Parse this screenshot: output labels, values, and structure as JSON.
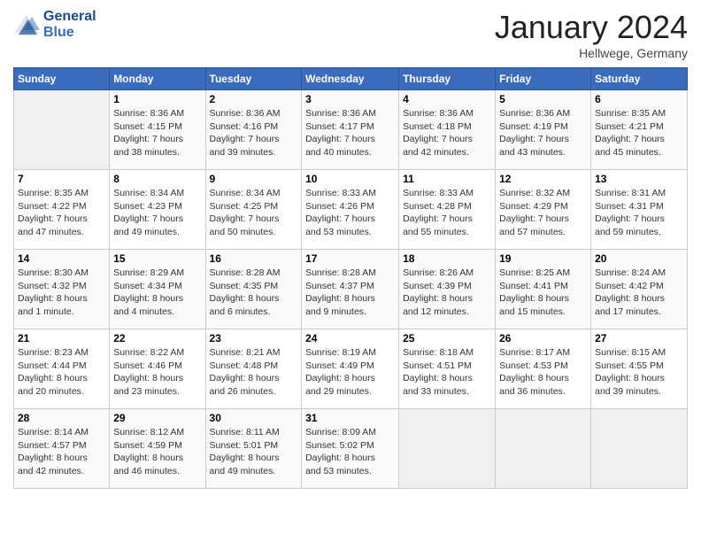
{
  "header": {
    "logo_line1": "General",
    "logo_line2": "Blue",
    "month": "January 2024",
    "location": "Hellwege, Germany"
  },
  "days_of_week": [
    "Sunday",
    "Monday",
    "Tuesday",
    "Wednesday",
    "Thursday",
    "Friday",
    "Saturday"
  ],
  "weeks": [
    [
      {
        "day": "",
        "info": ""
      },
      {
        "day": "1",
        "info": "Sunrise: 8:36 AM\nSunset: 4:15 PM\nDaylight: 7 hours\nand 38 minutes."
      },
      {
        "day": "2",
        "info": "Sunrise: 8:36 AM\nSunset: 4:16 PM\nDaylight: 7 hours\nand 39 minutes."
      },
      {
        "day": "3",
        "info": "Sunrise: 8:36 AM\nSunset: 4:17 PM\nDaylight: 7 hours\nand 40 minutes."
      },
      {
        "day": "4",
        "info": "Sunrise: 8:36 AM\nSunset: 4:18 PM\nDaylight: 7 hours\nand 42 minutes."
      },
      {
        "day": "5",
        "info": "Sunrise: 8:36 AM\nSunset: 4:19 PM\nDaylight: 7 hours\nand 43 minutes."
      },
      {
        "day": "6",
        "info": "Sunrise: 8:35 AM\nSunset: 4:21 PM\nDaylight: 7 hours\nand 45 minutes."
      }
    ],
    [
      {
        "day": "7",
        "info": "Sunrise: 8:35 AM\nSunset: 4:22 PM\nDaylight: 7 hours\nand 47 minutes."
      },
      {
        "day": "8",
        "info": "Sunrise: 8:34 AM\nSunset: 4:23 PM\nDaylight: 7 hours\nand 49 minutes."
      },
      {
        "day": "9",
        "info": "Sunrise: 8:34 AM\nSunset: 4:25 PM\nDaylight: 7 hours\nand 50 minutes."
      },
      {
        "day": "10",
        "info": "Sunrise: 8:33 AM\nSunset: 4:26 PM\nDaylight: 7 hours\nand 53 minutes."
      },
      {
        "day": "11",
        "info": "Sunrise: 8:33 AM\nSunset: 4:28 PM\nDaylight: 7 hours\nand 55 minutes."
      },
      {
        "day": "12",
        "info": "Sunrise: 8:32 AM\nSunset: 4:29 PM\nDaylight: 7 hours\nand 57 minutes."
      },
      {
        "day": "13",
        "info": "Sunrise: 8:31 AM\nSunset: 4:31 PM\nDaylight: 7 hours\nand 59 minutes."
      }
    ],
    [
      {
        "day": "14",
        "info": "Sunrise: 8:30 AM\nSunset: 4:32 PM\nDaylight: 8 hours\nand 1 minute."
      },
      {
        "day": "15",
        "info": "Sunrise: 8:29 AM\nSunset: 4:34 PM\nDaylight: 8 hours\nand 4 minutes."
      },
      {
        "day": "16",
        "info": "Sunrise: 8:28 AM\nSunset: 4:35 PM\nDaylight: 8 hours\nand 6 minutes."
      },
      {
        "day": "17",
        "info": "Sunrise: 8:28 AM\nSunset: 4:37 PM\nDaylight: 8 hours\nand 9 minutes."
      },
      {
        "day": "18",
        "info": "Sunrise: 8:26 AM\nSunset: 4:39 PM\nDaylight: 8 hours\nand 12 minutes."
      },
      {
        "day": "19",
        "info": "Sunrise: 8:25 AM\nSunset: 4:41 PM\nDaylight: 8 hours\nand 15 minutes."
      },
      {
        "day": "20",
        "info": "Sunrise: 8:24 AM\nSunset: 4:42 PM\nDaylight: 8 hours\nand 17 minutes."
      }
    ],
    [
      {
        "day": "21",
        "info": "Sunrise: 8:23 AM\nSunset: 4:44 PM\nDaylight: 8 hours\nand 20 minutes."
      },
      {
        "day": "22",
        "info": "Sunrise: 8:22 AM\nSunset: 4:46 PM\nDaylight: 8 hours\nand 23 minutes."
      },
      {
        "day": "23",
        "info": "Sunrise: 8:21 AM\nSunset: 4:48 PM\nDaylight: 8 hours\nand 26 minutes."
      },
      {
        "day": "24",
        "info": "Sunrise: 8:19 AM\nSunset: 4:49 PM\nDaylight: 8 hours\nand 29 minutes."
      },
      {
        "day": "25",
        "info": "Sunrise: 8:18 AM\nSunset: 4:51 PM\nDaylight: 8 hours\nand 33 minutes."
      },
      {
        "day": "26",
        "info": "Sunrise: 8:17 AM\nSunset: 4:53 PM\nDaylight: 8 hours\nand 36 minutes."
      },
      {
        "day": "27",
        "info": "Sunrise: 8:15 AM\nSunset: 4:55 PM\nDaylight: 8 hours\nand 39 minutes."
      }
    ],
    [
      {
        "day": "28",
        "info": "Sunrise: 8:14 AM\nSunset: 4:57 PM\nDaylight: 8 hours\nand 42 minutes."
      },
      {
        "day": "29",
        "info": "Sunrise: 8:12 AM\nSunset: 4:59 PM\nDaylight: 8 hours\nand 46 minutes."
      },
      {
        "day": "30",
        "info": "Sunrise: 8:11 AM\nSunset: 5:01 PM\nDaylight: 8 hours\nand 49 minutes."
      },
      {
        "day": "31",
        "info": "Sunrise: 8:09 AM\nSunset: 5:02 PM\nDaylight: 8 hours\nand 53 minutes."
      },
      {
        "day": "",
        "info": ""
      },
      {
        "day": "",
        "info": ""
      },
      {
        "day": "",
        "info": ""
      }
    ]
  ]
}
